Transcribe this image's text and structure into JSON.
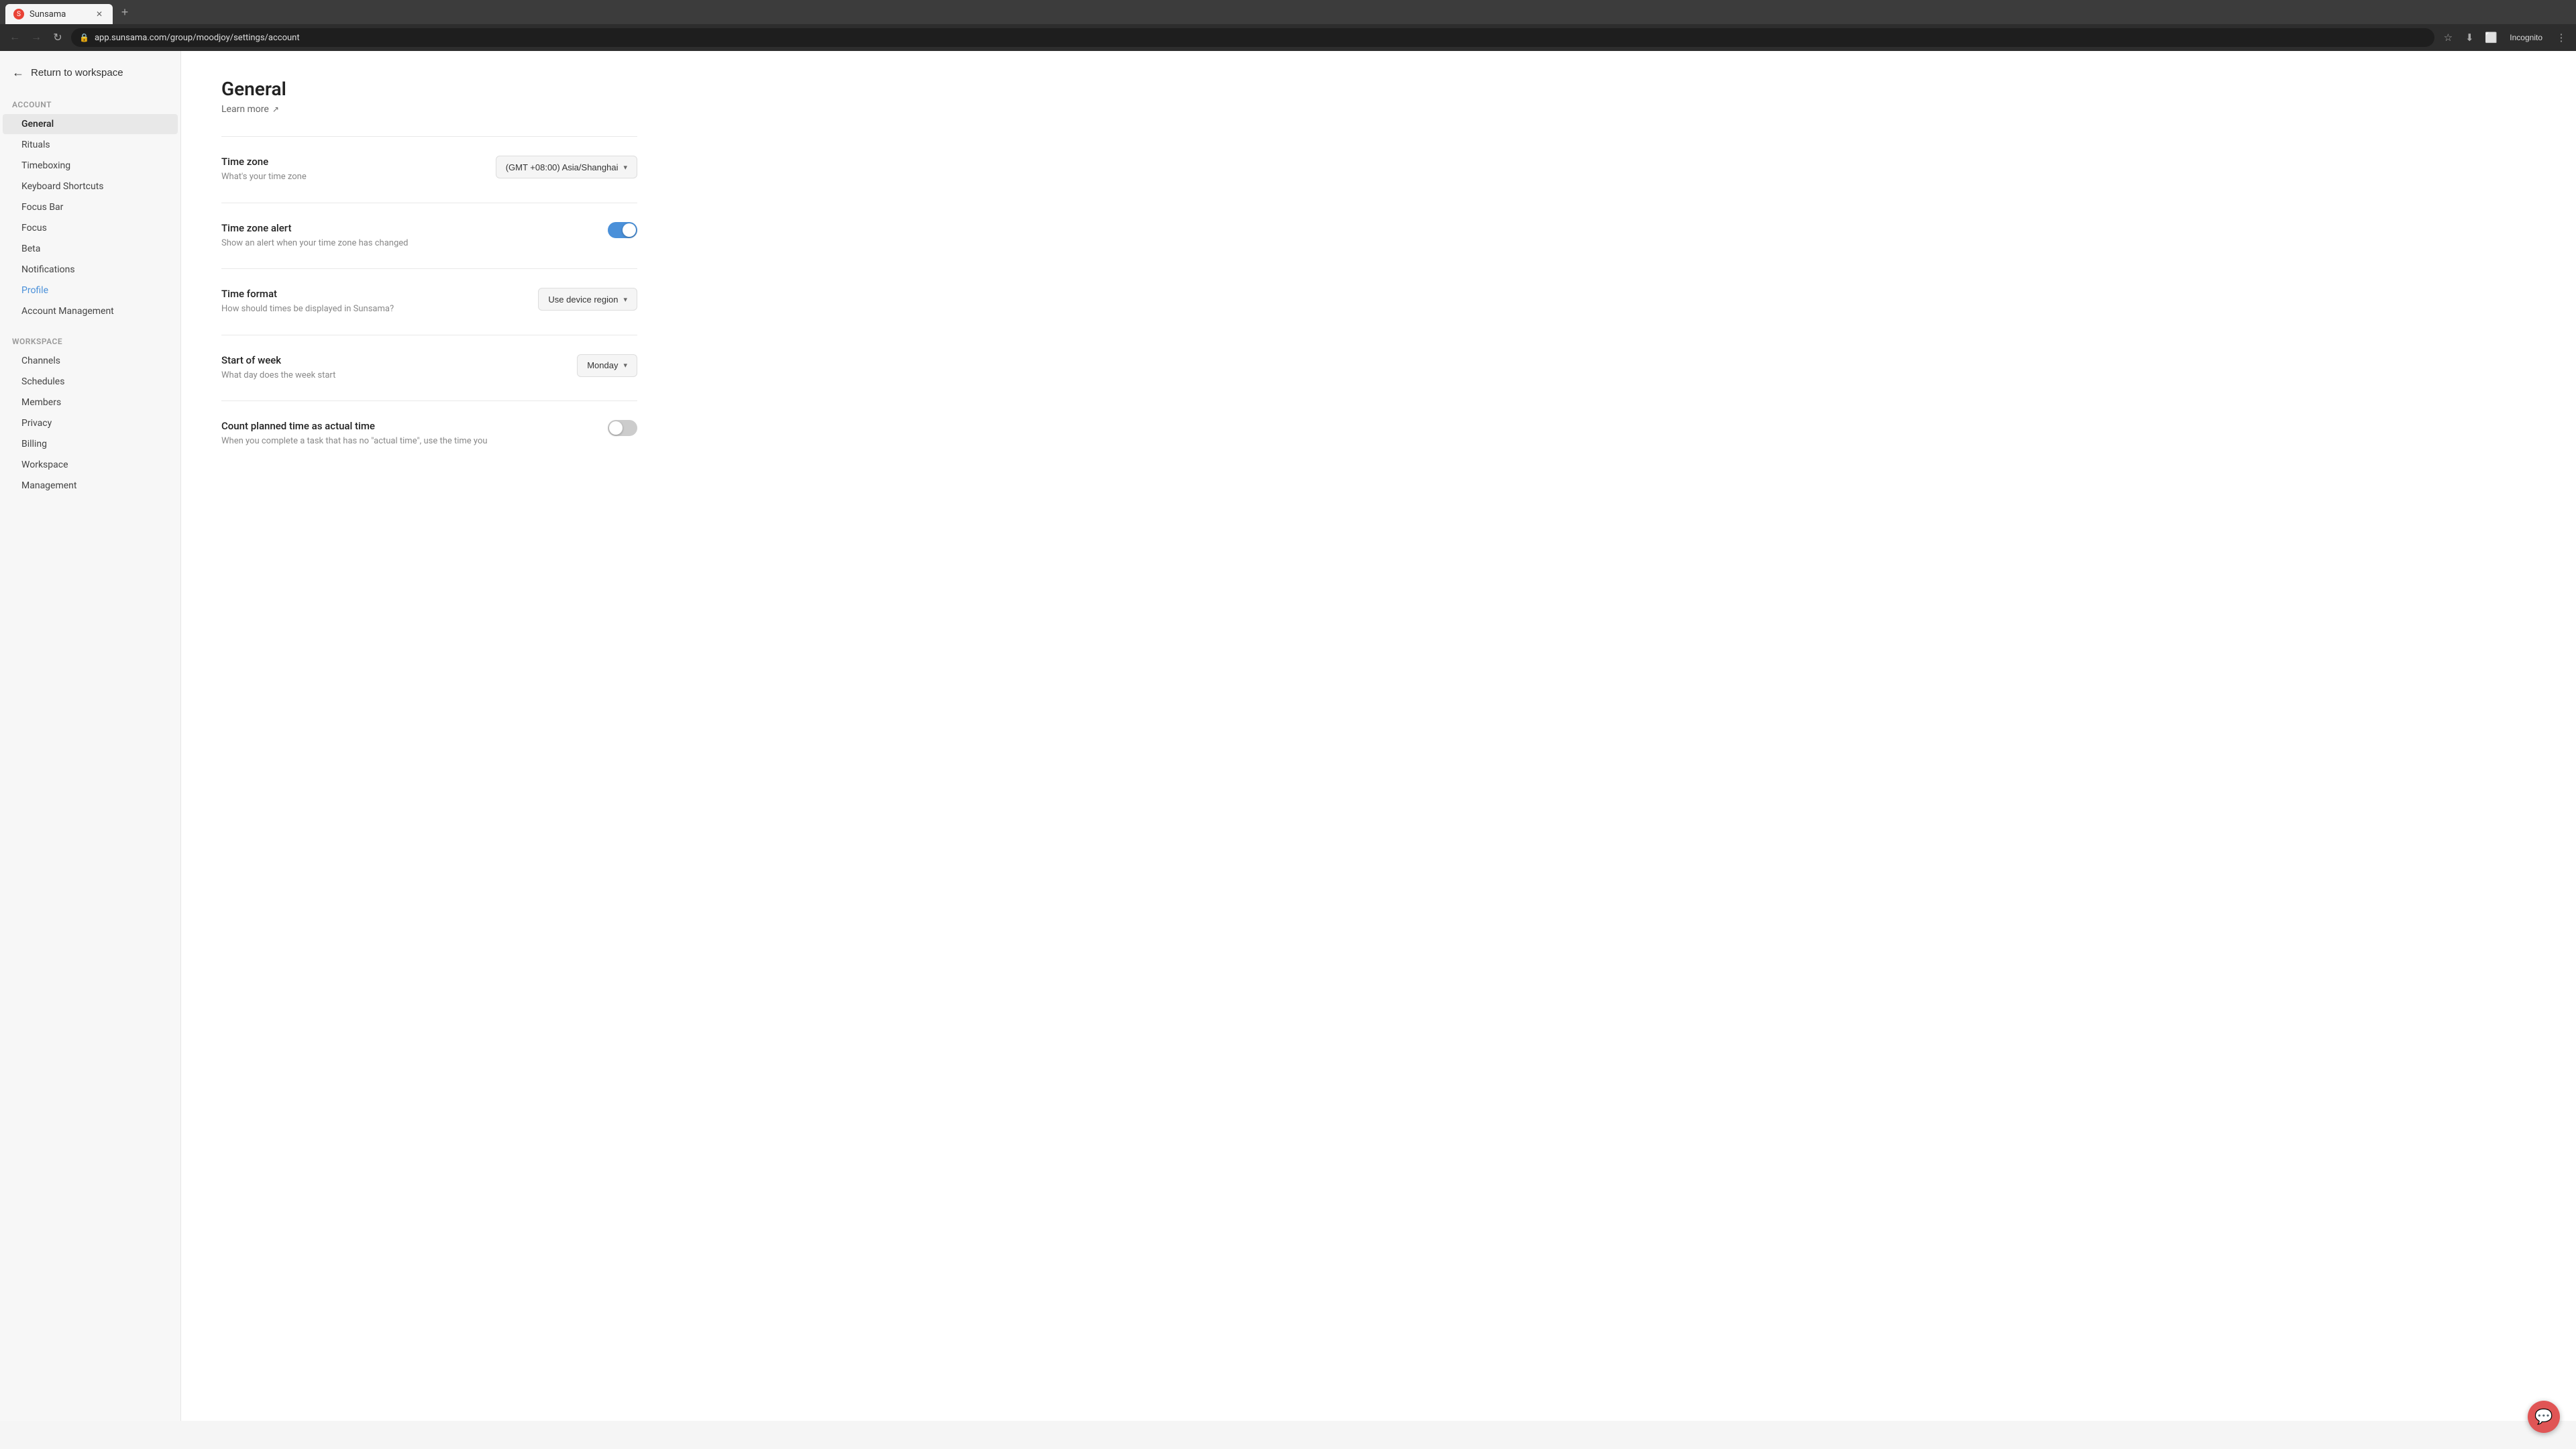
{
  "browser": {
    "tab_title": "Sunsama",
    "tab_icon_color": "#e94235",
    "address": "app.sunsama.com/group/moodjoy/settings/account",
    "profile_label": "Incognito",
    "new_tab_tooltip": "New tab"
  },
  "return_button": {
    "label": "Return to workspace"
  },
  "sidebar": {
    "account_section_title": "Account",
    "account_items": [
      {
        "id": "general",
        "label": "General",
        "active": true
      },
      {
        "id": "rituals",
        "label": "Rituals",
        "active": false
      },
      {
        "id": "timeboxing",
        "label": "Timeboxing",
        "active": false
      },
      {
        "id": "keyboard-shortcuts",
        "label": "Keyboard Shortcuts",
        "active": false
      },
      {
        "id": "focus-bar",
        "label": "Focus Bar",
        "active": false
      },
      {
        "id": "focus",
        "label": "Focus",
        "active": false
      },
      {
        "id": "beta",
        "label": "Beta",
        "active": false
      },
      {
        "id": "notifications",
        "label": "Notifications",
        "active": false
      },
      {
        "id": "profile",
        "label": "Profile",
        "active": false,
        "hovered": true
      },
      {
        "id": "account-management",
        "label": "Account Management",
        "active": false
      }
    ],
    "workspace_section_title": "Workspace",
    "workspace_items": [
      {
        "id": "channels",
        "label": "Channels"
      },
      {
        "id": "schedules",
        "label": "Schedules"
      },
      {
        "id": "members",
        "label": "Members"
      },
      {
        "id": "privacy",
        "label": "Privacy"
      },
      {
        "id": "billing",
        "label": "Billing"
      },
      {
        "id": "workspace",
        "label": "Workspace"
      },
      {
        "id": "management",
        "label": "Management"
      }
    ]
  },
  "main": {
    "page_title": "General",
    "learn_more_label": "Learn more",
    "sections": [
      {
        "id": "time-zone",
        "label": "Time zone",
        "description": "What's your time zone",
        "control_type": "dropdown",
        "control_value": "(GMT +08:00) Asia/Shanghai"
      },
      {
        "id": "time-zone-alert",
        "label": "Time zone alert",
        "description": "Show an alert when your time zone has changed",
        "control_type": "toggle",
        "toggle_on": true
      },
      {
        "id": "time-format",
        "label": "Time format",
        "description": "How should times be displayed in Sunsama?",
        "control_type": "dropdown",
        "control_value": "Use device region"
      },
      {
        "id": "start-of-week",
        "label": "Start of week",
        "description": "What day does the week start",
        "control_type": "dropdown",
        "control_value": "Monday"
      },
      {
        "id": "count-planned-time",
        "label": "Count planned time as actual time",
        "description": "When you complete a task that has no \"actual time\", use the time you",
        "control_type": "toggle",
        "toggle_on": false
      }
    ]
  },
  "chat_button_label": "💬"
}
